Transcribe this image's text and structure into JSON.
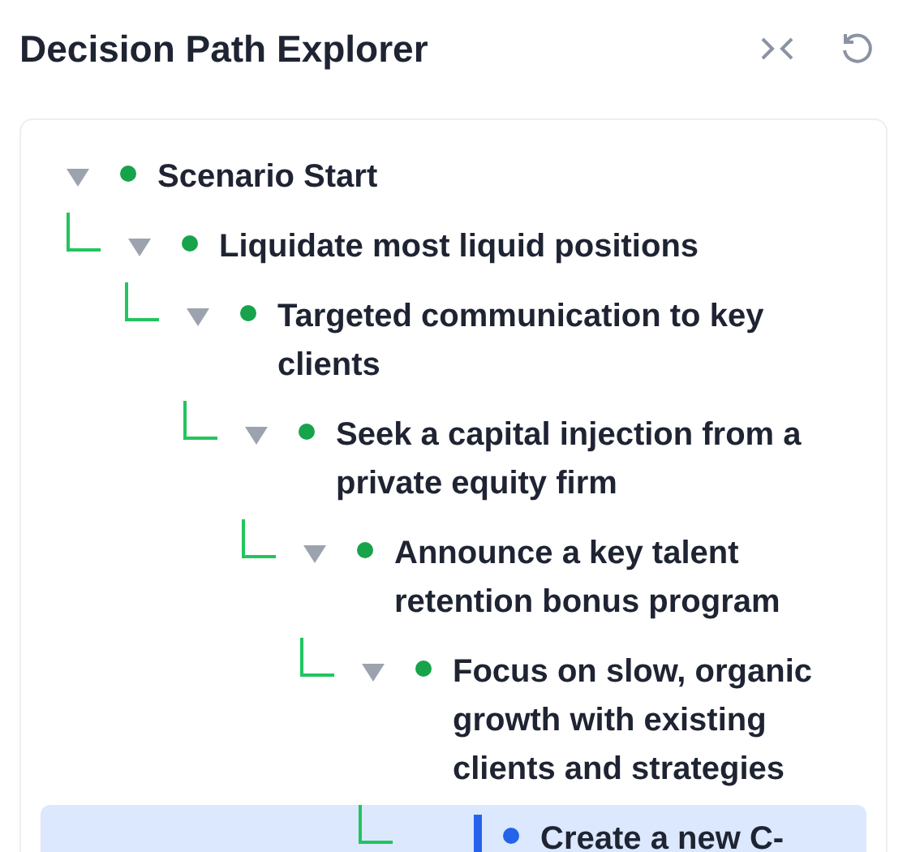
{
  "title": "Decision Path Explorer",
  "tree": [
    {
      "label": "Scenario Start",
      "expanded": true,
      "selected": false,
      "children": [
        {
          "label": "Liquidate most liquid positions",
          "expanded": true,
          "selected": false,
          "children": [
            {
              "label": "Targeted communication to key clients",
              "expanded": true,
              "selected": false,
              "children": [
                {
                  "label": "Seek a capital injection from a private equity firm",
                  "expanded": true,
                  "selected": false,
                  "children": [
                    {
                      "label": "Announce a key talent retention bonus program",
                      "expanded": true,
                      "selected": false,
                      "children": [
                        {
                          "label": "Focus on slow, organic growth with existing clients and strategies",
                          "expanded": true,
                          "selected": false,
                          "children": [
                            {
                              "label": "Create a new C-",
                              "selected": true
                            }
                          ]
                        }
                      ]
                    }
                  ]
                }
              ]
            }
          ]
        }
      ]
    }
  ]
}
